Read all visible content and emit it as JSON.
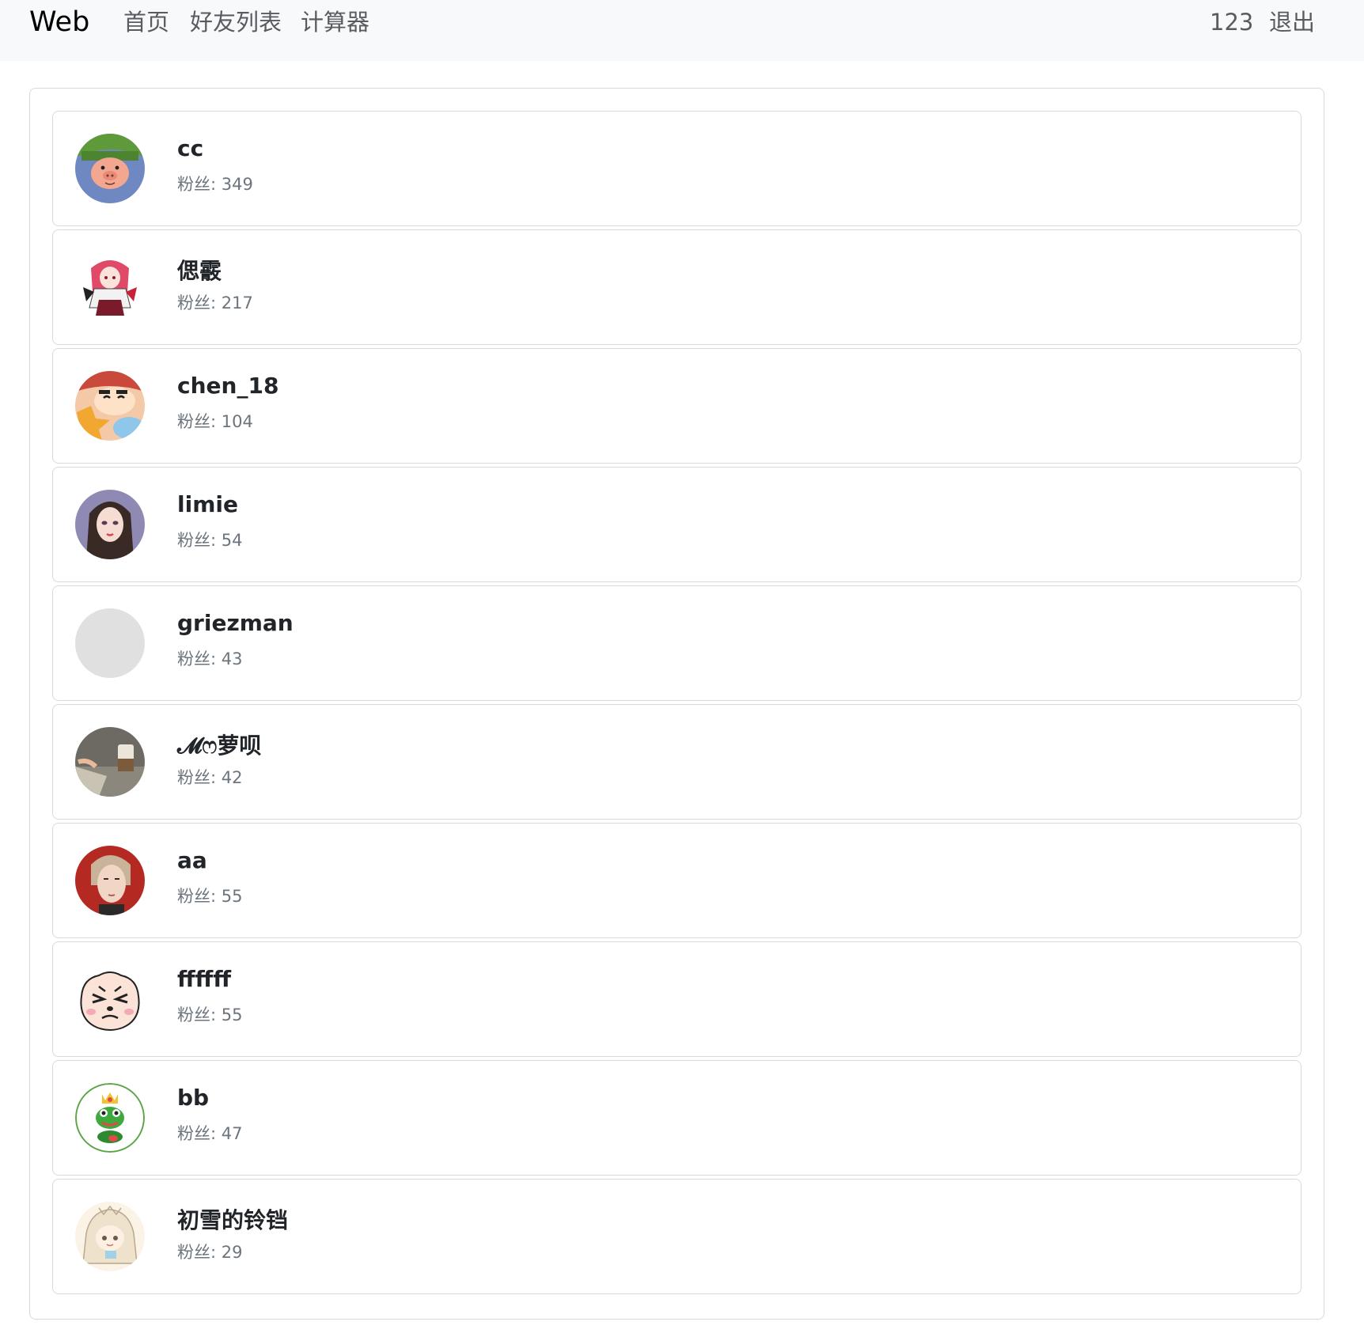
{
  "navbar": {
    "brand": "Web",
    "links": [
      "首页",
      "好友列表",
      "计算器"
    ],
    "username": "123",
    "logout": "退出"
  },
  "fans_label": "粉丝: ",
  "friends": [
    {
      "name": "cc",
      "fans": "349",
      "avatar": "pig-avatar-icon"
    },
    {
      "name": "偲霰",
      "fans": "217",
      "avatar": "anime-girl-avatar-icon"
    },
    {
      "name": "chen_18",
      "fans": "104",
      "avatar": "cartoon-boy-avatar-icon"
    },
    {
      "name": "limie",
      "fans": "54",
      "avatar": "girl-portrait-avatar-icon"
    },
    {
      "name": "griezman",
      "fans": "43",
      "avatar": "blank-avatar-icon"
    },
    {
      "name": "𝓜ෆ萝呗",
      "fans": "42",
      "avatar": "coffee-photo-avatar-icon"
    },
    {
      "name": "aa",
      "fans": "55",
      "avatar": "man-portrait-avatar-icon"
    },
    {
      "name": "ffffff",
      "fans": "55",
      "avatar": "angry-face-avatar-icon"
    },
    {
      "name": "bb",
      "fans": "47",
      "avatar": "frog-king-avatar-icon"
    },
    {
      "name": "初雪的铃铛",
      "fans": "29",
      "avatar": "chibi-girl-avatar-icon"
    }
  ]
}
